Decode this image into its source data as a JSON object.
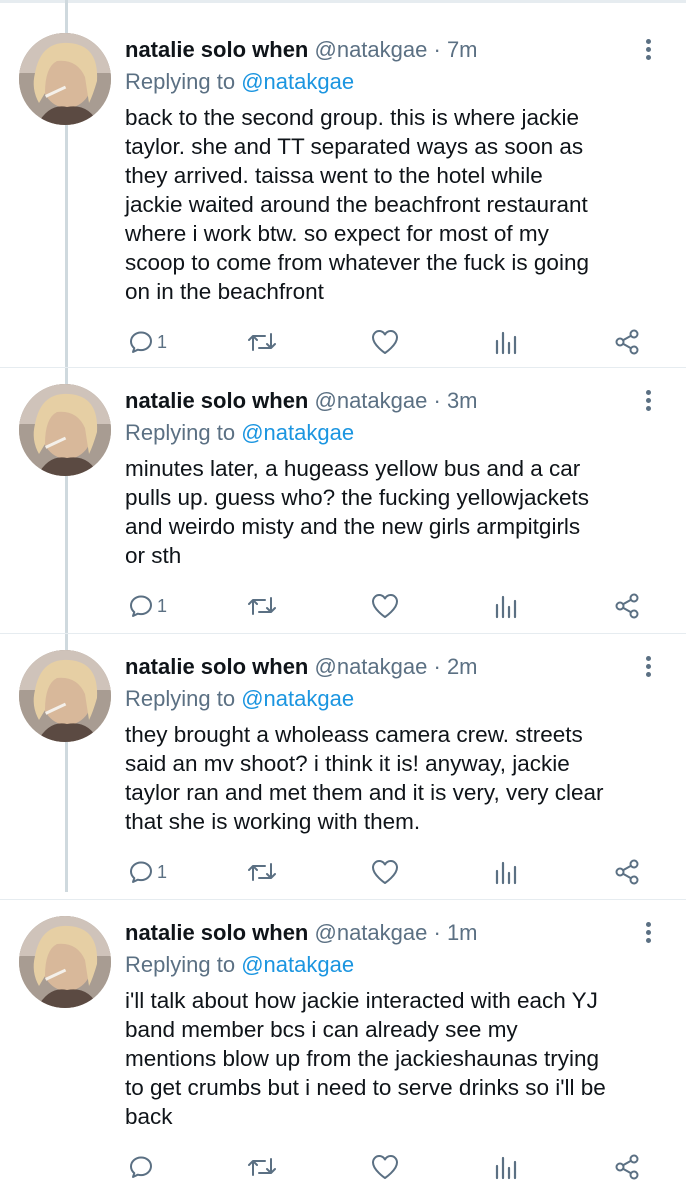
{
  "colors": {
    "text": "#0f1419",
    "secondary": "#5b7083",
    "link": "#1b95e0",
    "divider": "#e6ecf0",
    "thread_line": "#cfd9de"
  },
  "tweets": [
    {
      "name": "natalie solo when",
      "handle": "@natakgae",
      "separator": "·",
      "time": "7m",
      "replying_prefix": "Replying to",
      "replying_to": "@natakgae",
      "text": "back to the second group. this is where jackie\ntaylor. she and TT separated ways as soon as\nthey arrived. taissa went to the hotel while\njackie waited around the beachfront restaurant\nwhere i work btw. so expect for most of my\nscoop to come from whatever the fuck is going\non in the beachfront",
      "reply_count": "1",
      "icons": [
        "reply-icon",
        "retweet-icon",
        "like-icon",
        "analytics-icon",
        "share-icon"
      ]
    },
    {
      "name": "natalie solo when",
      "handle": "@natakgae",
      "separator": "·",
      "time": "3m",
      "replying_prefix": "Replying to",
      "replying_to": "@natakgae",
      "text": "minutes later, a hugeass yellow bus and a car\npulls up. guess who? the fucking yellowjackets\nand weirdo misty and the new girls armpitgirls\nor sth",
      "reply_count": "1",
      "icons": [
        "reply-icon",
        "retweet-icon",
        "like-icon",
        "analytics-icon",
        "share-icon"
      ]
    },
    {
      "name": "natalie solo when",
      "handle": "@natakgae",
      "separator": "·",
      "time": "2m",
      "replying_prefix": "Replying to",
      "replying_to": "@natakgae",
      "text": "they brought a wholeass camera crew. streets\nsaid an mv shoot? i think it is! anyway, jackie\ntaylor ran and met them and it is very, very clear\nthat she is working with them.",
      "reply_count": "1",
      "icons": [
        "reply-icon",
        "retweet-icon",
        "like-icon",
        "analytics-icon",
        "share-icon"
      ]
    },
    {
      "name": "natalie solo when",
      "handle": "@natakgae",
      "separator": "·",
      "time": "1m",
      "replying_prefix": "Replying to",
      "replying_to": "@natakgae",
      "text": "i'll talk about how jackie interacted with each YJ\nband member bcs i can already see my\nmentions blow up from the jackieshaunas trying\nto get crumbs but i need to serve drinks so i'll be\nback",
      "reply_count": "",
      "icons": [
        "reply-icon",
        "retweet-icon",
        "like-icon",
        "analytics-icon",
        "share-icon"
      ]
    }
  ]
}
